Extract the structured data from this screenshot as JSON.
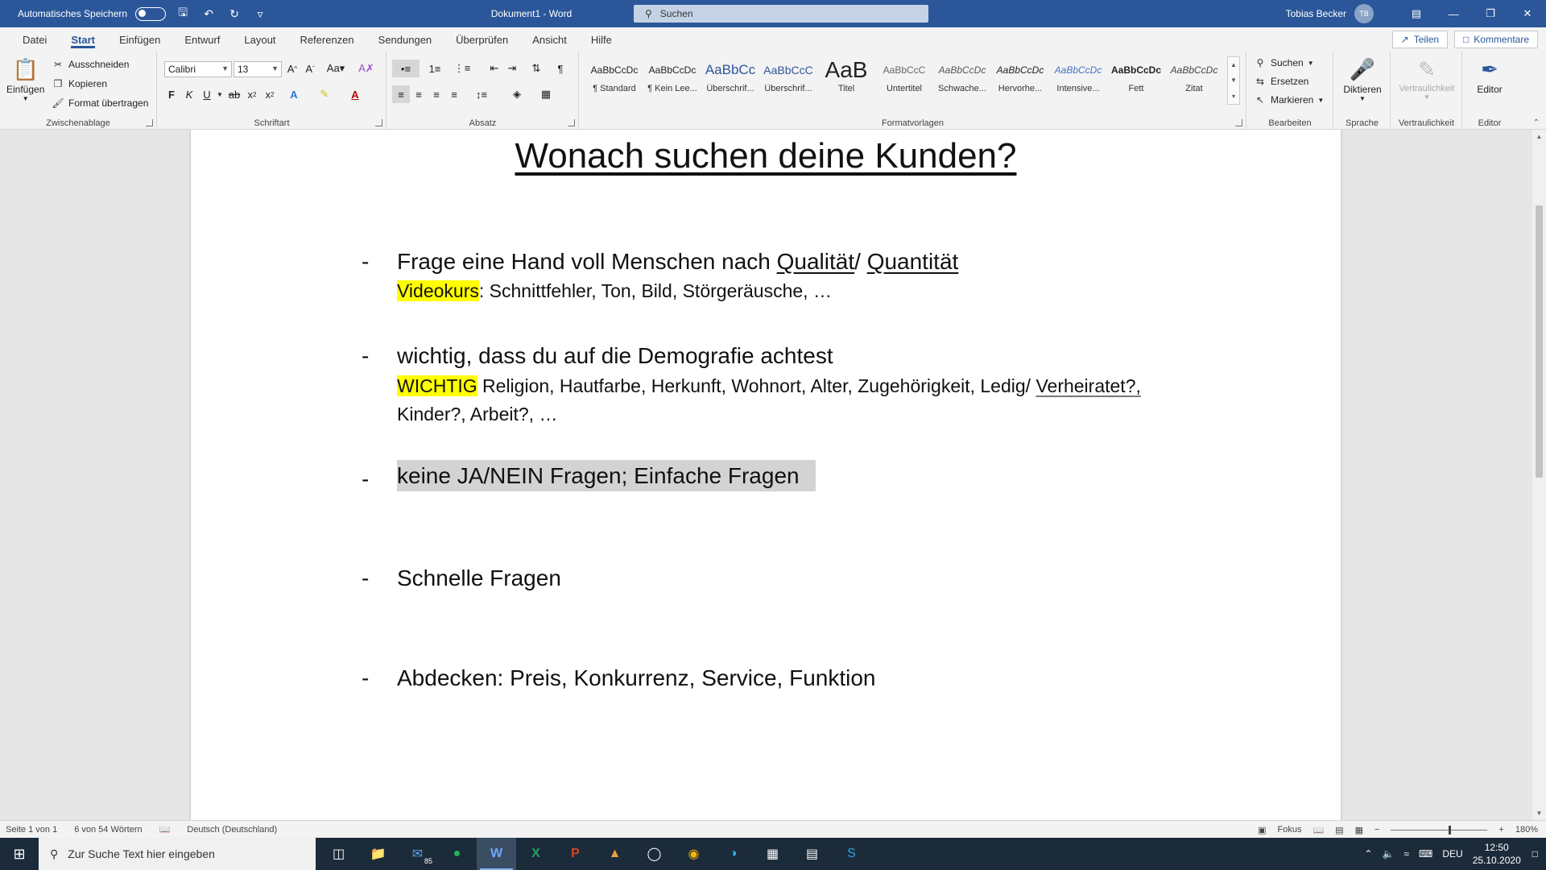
{
  "titlebar": {
    "autosave_label": "Automatisches Speichern",
    "doc_title": "Dokument1  -  Word",
    "search_placeholder": "Suchen",
    "user_name": "Tobias Becker",
    "user_initials": "TB"
  },
  "tabs": [
    "Datei",
    "Start",
    "Einfügen",
    "Entwurf",
    "Layout",
    "Referenzen",
    "Sendungen",
    "Überprüfen",
    "Ansicht",
    "Hilfe"
  ],
  "active_tab": "Start",
  "tab_actions": {
    "share": "Teilen",
    "comments": "Kommentare"
  },
  "ribbon": {
    "clipboard": {
      "label": "Zwischenablage",
      "paste": "Einfügen",
      "cut": "Ausschneiden",
      "copy": "Kopieren",
      "format_painter": "Format übertragen"
    },
    "font": {
      "label": "Schriftart",
      "font_name": "Calibri",
      "font_size": "13"
    },
    "paragraph": {
      "label": "Absatz"
    },
    "styles": {
      "label": "Formatvorlagen",
      "items": [
        {
          "sample": "AaBbCcDc",
          "name": "¶ Standard"
        },
        {
          "sample": "AaBbCcDc",
          "name": "¶ Kein Lee..."
        },
        {
          "sample": "AaBbCc",
          "name": "Überschrif..."
        },
        {
          "sample": "AaBbCcC",
          "name": "Überschrif..."
        },
        {
          "sample": "AaB",
          "name": "Titel"
        },
        {
          "sample": "AaBbCcC",
          "name": "Untertitel"
        },
        {
          "sample": "AaBbCcDc",
          "name": "Schwache..."
        },
        {
          "sample": "AaBbCcDc",
          "name": "Hervorhe..."
        },
        {
          "sample": "AaBbCcDc",
          "name": "Intensive..."
        },
        {
          "sample": "AaBbCcDc",
          "name": "Fett"
        },
        {
          "sample": "AaBbCcDc",
          "name": "Zitat"
        }
      ]
    },
    "editing": {
      "label": "Bearbeiten",
      "find": "Suchen",
      "replace": "Ersetzen",
      "select": "Markieren"
    },
    "voice": {
      "label": "Sprache",
      "dictate": "Diktieren"
    },
    "sensitivity": {
      "label": "Vertraulichkeit",
      "button": "Vertraulichkeit"
    },
    "editor": {
      "label": "Editor",
      "button": "Editor"
    }
  },
  "document": {
    "heading": "Wonach suchen deine Kunden?",
    "bullet_char": "-",
    "items": {
      "i1_a": "Frage eine Hand voll Menschen nach ",
      "i1_q1": "Qualität",
      "i1_sep": "/ ",
      "i1_q2": "Quantität",
      "i1_hl": "Videokurs",
      "i1_rest": ": Schnittfehler, Ton, Bild, Störgeräusche, …",
      "i2_a": "wichtig, dass du auf die Demografie achtest",
      "i2_hl": "WICHTIG",
      "i2_rest": " Religion, Hautfarbe, Herkunft, Wohnort, Alter, Zugehörigkeit, Ledig/ ",
      "i2_u": "Verheiratet?,",
      "i2_cont": "Kinder?, Arbeit?, …",
      "i3": "keine JA/NEIN Fragen; Einfache Fragen",
      "i4": "Schnelle Fragen",
      "i5": "Abdecken: Preis, Konkurrenz, Service, Funktion"
    }
  },
  "statusbar": {
    "page": "Seite 1 von 1",
    "words": "6 von 54 Wörtern",
    "language": "Deutsch (Deutschland)",
    "focus": "Fokus",
    "zoom": "180%"
  },
  "taskbar": {
    "search_placeholder": "Zur Suche Text hier eingeben",
    "mail_badge": "85",
    "lang": "DEU",
    "time": "12:50",
    "date": "25.10.2020"
  }
}
